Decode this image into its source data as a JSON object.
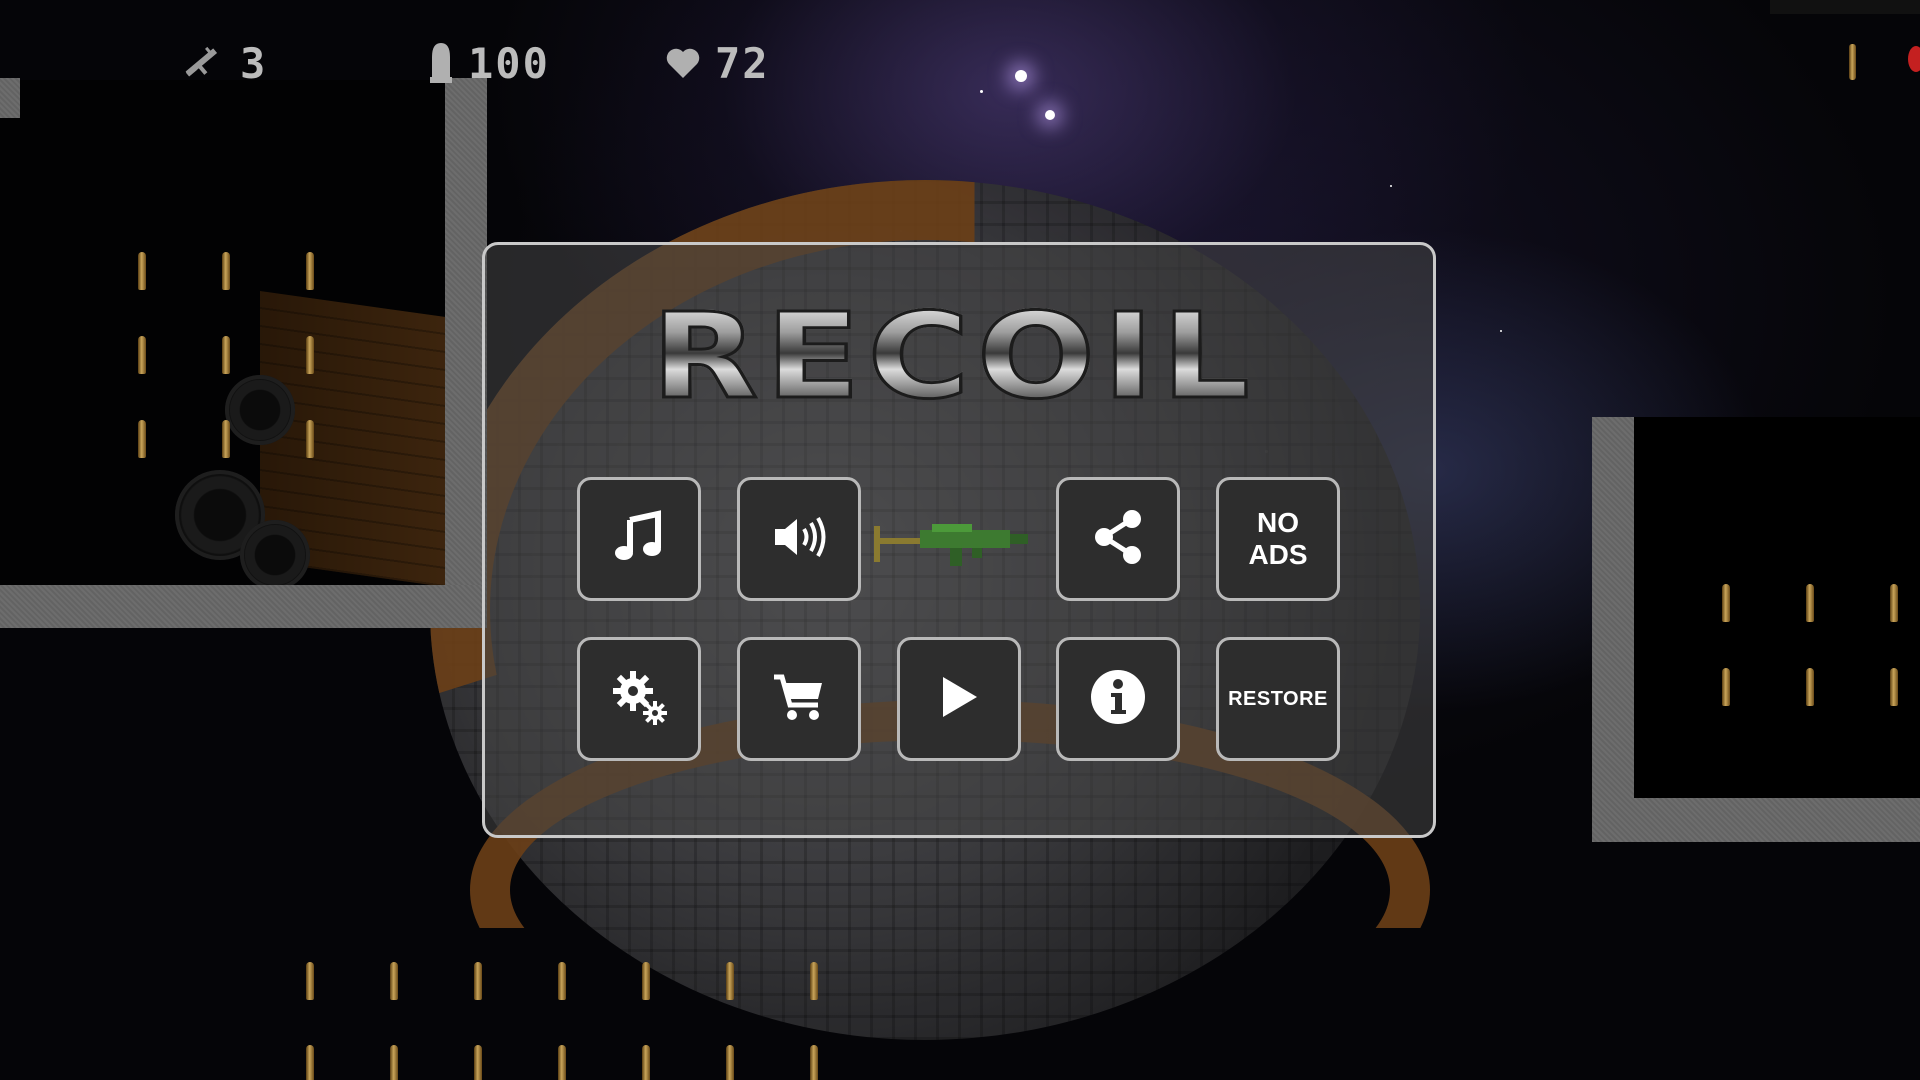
{
  "hud": {
    "weapons_icon": "rifle-icon",
    "weapons_count": "3",
    "ammo_icon": "bullet-icon",
    "ammo_count": "100",
    "health_icon": "heart-icon",
    "health_count": "72"
  },
  "menu": {
    "logo_text": "RECOIL",
    "buttons": {
      "music": {
        "icon": "music-note-icon"
      },
      "sound": {
        "icon": "speaker-icon"
      },
      "share": {
        "icon": "share-icon"
      },
      "no_ads": {
        "line1": "NO",
        "line2": "ADS"
      },
      "settings": {
        "icon": "gears-icon"
      },
      "shop": {
        "icon": "cart-icon"
      },
      "play": {
        "icon": "play-icon"
      },
      "info": {
        "icon": "info-icon"
      },
      "restore": {
        "label": "RESTORE"
      }
    },
    "selected_weapon_icon": "green-rifle-icon"
  },
  "colors": {
    "panel_border": "#c9c9c9",
    "button_bg": "#2d2d2d",
    "hud_text": "#bcbcbc",
    "wall": "#686868",
    "bullet": "#c9a55a"
  }
}
